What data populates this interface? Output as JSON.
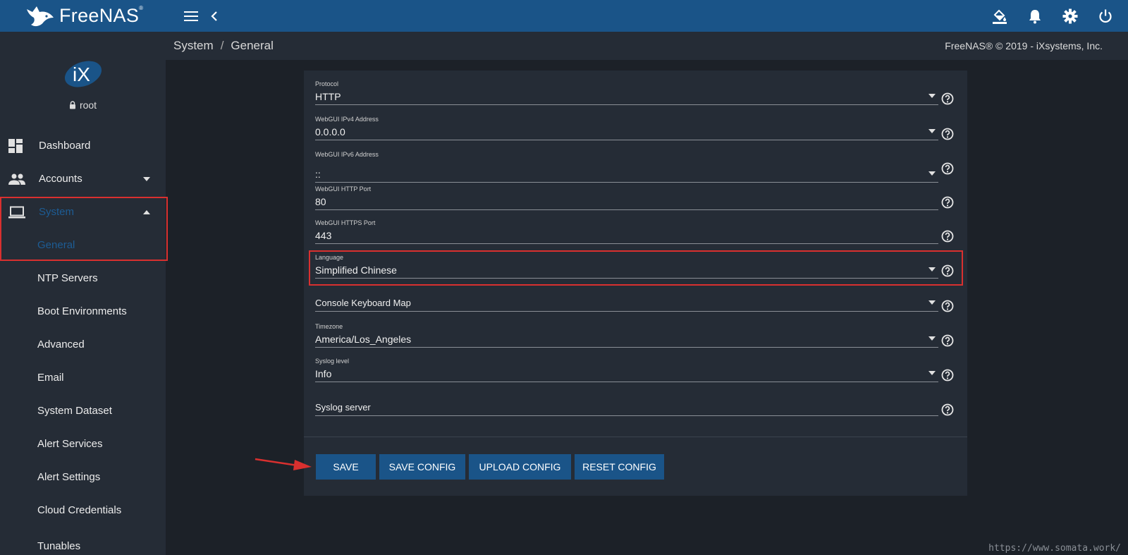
{
  "header": {
    "brand": "FreeNAS",
    "brand_mark": "®",
    "menu_icon": "menu-icon",
    "back_icon": "chevron-left-icon",
    "right_icons": [
      "paint-bucket-icon",
      "bell-icon",
      "gear-icon",
      "power-icon"
    ]
  },
  "sidebar": {
    "logo_text": "iX",
    "user": "root",
    "items": [
      {
        "label": "Dashboard",
        "icon": "dashboard-icon"
      },
      {
        "label": "Accounts",
        "icon": "people-icon"
      },
      {
        "label": "System",
        "icon": "laptop-icon"
      }
    ],
    "system_sub": [
      "General",
      "NTP Servers",
      "Boot Environments",
      "Advanced",
      "Email",
      "System Dataset",
      "Alert Services",
      "Alert Settings",
      "Cloud Credentials",
      "Tunables"
    ]
  },
  "breadcrumb": {
    "root": "System",
    "sep": "/",
    "current": "General"
  },
  "copyright": "FreeNAS® © 2019 - iXsystems, Inc.",
  "form": {
    "protocol": {
      "label": "Protocol",
      "value": "HTTP"
    },
    "ipv4": {
      "label": "WebGUI IPv4 Address",
      "value": "0.0.0.0"
    },
    "ipv6": {
      "label": "WebGUI IPv6 Address",
      "value": "::"
    },
    "http_port": {
      "label": "WebGUI HTTP Port",
      "value": "80"
    },
    "https_port": {
      "label": "WebGUI HTTPS Port",
      "value": "443"
    },
    "language": {
      "label": "Language",
      "value": "Simplified Chinese"
    },
    "keyboard": {
      "placeholder": "Console Keyboard Map"
    },
    "timezone": {
      "label": "Timezone",
      "value": "America/Los_Angeles"
    },
    "syslog_level": {
      "label": "Syslog level",
      "value": "Info"
    },
    "syslog_server": {
      "placeholder": "Syslog server"
    }
  },
  "buttons": {
    "save": "SAVE",
    "save_config": "SAVE CONFIG",
    "upload_config": "UPLOAD CONFIG",
    "reset_config": "RESET CONFIG"
  },
  "watermark": "https://www.somata.work/",
  "colors": {
    "accent": "#1a5488",
    "highlight": "#d9302f",
    "active": "#1d5c94"
  }
}
